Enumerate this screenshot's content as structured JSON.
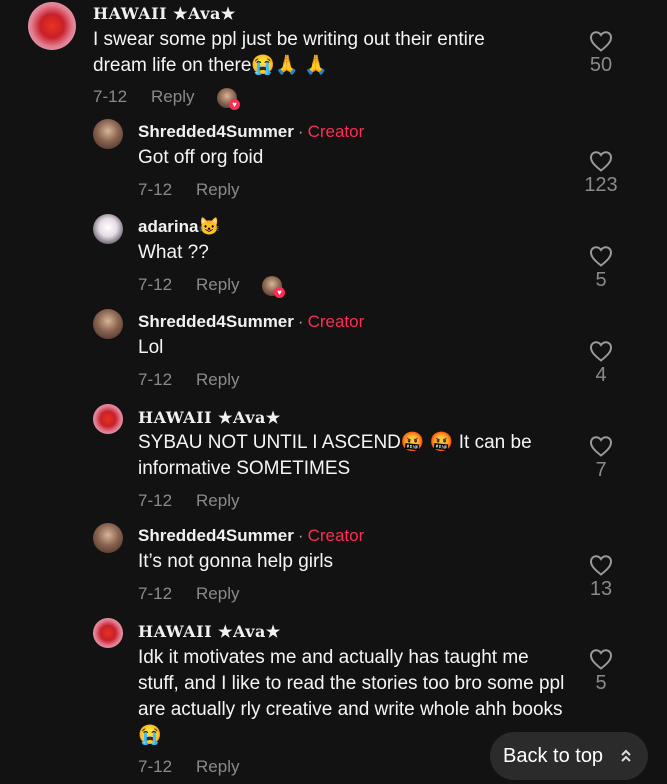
{
  "colors": {
    "background": "#121212",
    "creator": "#fe2c55",
    "muted": "#8a8a8a",
    "button": "#2b2b2b"
  },
  "comments": [
    {
      "username": "HAWAII ★Ava★",
      "text": "I swear some ppl just be writing out their entire dream life on there😭🙏 🙏",
      "date": "7-12",
      "reply": "Reply",
      "likes": "50"
    },
    {
      "username": "Shredded4Summer",
      "sep": "·",
      "badge": "Creator",
      "text": "Got off org foid",
      "date": "7-12",
      "reply": "Reply",
      "likes": "123"
    },
    {
      "username": "adarina😺",
      "text": "What ??",
      "date": "7-12",
      "reply": "Reply",
      "likes": "5"
    },
    {
      "username": "Shredded4Summer",
      "sep": "·",
      "badge": "Creator",
      "text": "Lol",
      "date": "7-12",
      "reply": "Reply",
      "likes": "4"
    },
    {
      "username": "HAWAII ★Ava★",
      "text": "SYBAU NOT UNTIL I ASCEND🤬 🤬 It can be informative SOMETIMES",
      "date": "7-12",
      "reply": "Reply",
      "likes": "7"
    },
    {
      "username": "Shredded4Summer",
      "sep": "·",
      "badge": "Creator",
      "text": "It’s not gonna help girls",
      "date": "7-12",
      "reply": "Reply",
      "likes": "13"
    },
    {
      "username": "HAWAII ★Ava★",
      "text": "Idk it motivates me and actually has taught me stuff, and I like to read the stories too bro some ppl are actually rly creative and write whole ahh books😭",
      "date": "7-12",
      "reply": "Reply",
      "likes": "5"
    }
  ],
  "back_to_top": {
    "label": "Back to top",
    "icon": "double-chevron-up-icon"
  }
}
